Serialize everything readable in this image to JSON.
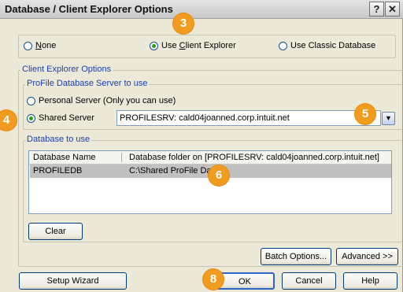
{
  "window": {
    "title": "Database / Client Explorer Options",
    "help_glyph": "?",
    "close_glyph": "✕"
  },
  "mode": {
    "none_label": "None",
    "client_explorer_label": "Use Client Explorer",
    "classic_label": "Use Classic Database",
    "selected": "client_explorer"
  },
  "client_explorer_options": {
    "legend": "Client Explorer Options"
  },
  "server_group": {
    "legend": "ProFile Database Server to use",
    "personal_label": "Personal Server (Only you can use)",
    "shared_label": "Shared Server",
    "selected": "shared",
    "server_value": "PROFILESRV: cald04joanned.corp.intuit.net"
  },
  "database_group": {
    "legend": "Database to use",
    "columns": [
      "Database Name",
      "Database folder on [PROFILESRV: cald04joanned.corp.intuit.net]"
    ],
    "rows": [
      {
        "name": "PROFILEDB",
        "folder": "C:\\Shared ProFile Dat"
      }
    ],
    "clear_label": "Clear"
  },
  "buttons": {
    "batch_options": "Batch Options...",
    "advanced": "Advanced >>",
    "setup_wizard": "Setup Wizard",
    "ok": "OK",
    "cancel": "Cancel",
    "help": "Help"
  },
  "callouts": {
    "c3": "3",
    "c4": "4",
    "c5": "5",
    "c6": "6",
    "c8": "8"
  },
  "colors": {
    "callout": "#f29c1f",
    "legend_text": "#1a3fb0",
    "dialog_bg": "#ece9d8"
  }
}
